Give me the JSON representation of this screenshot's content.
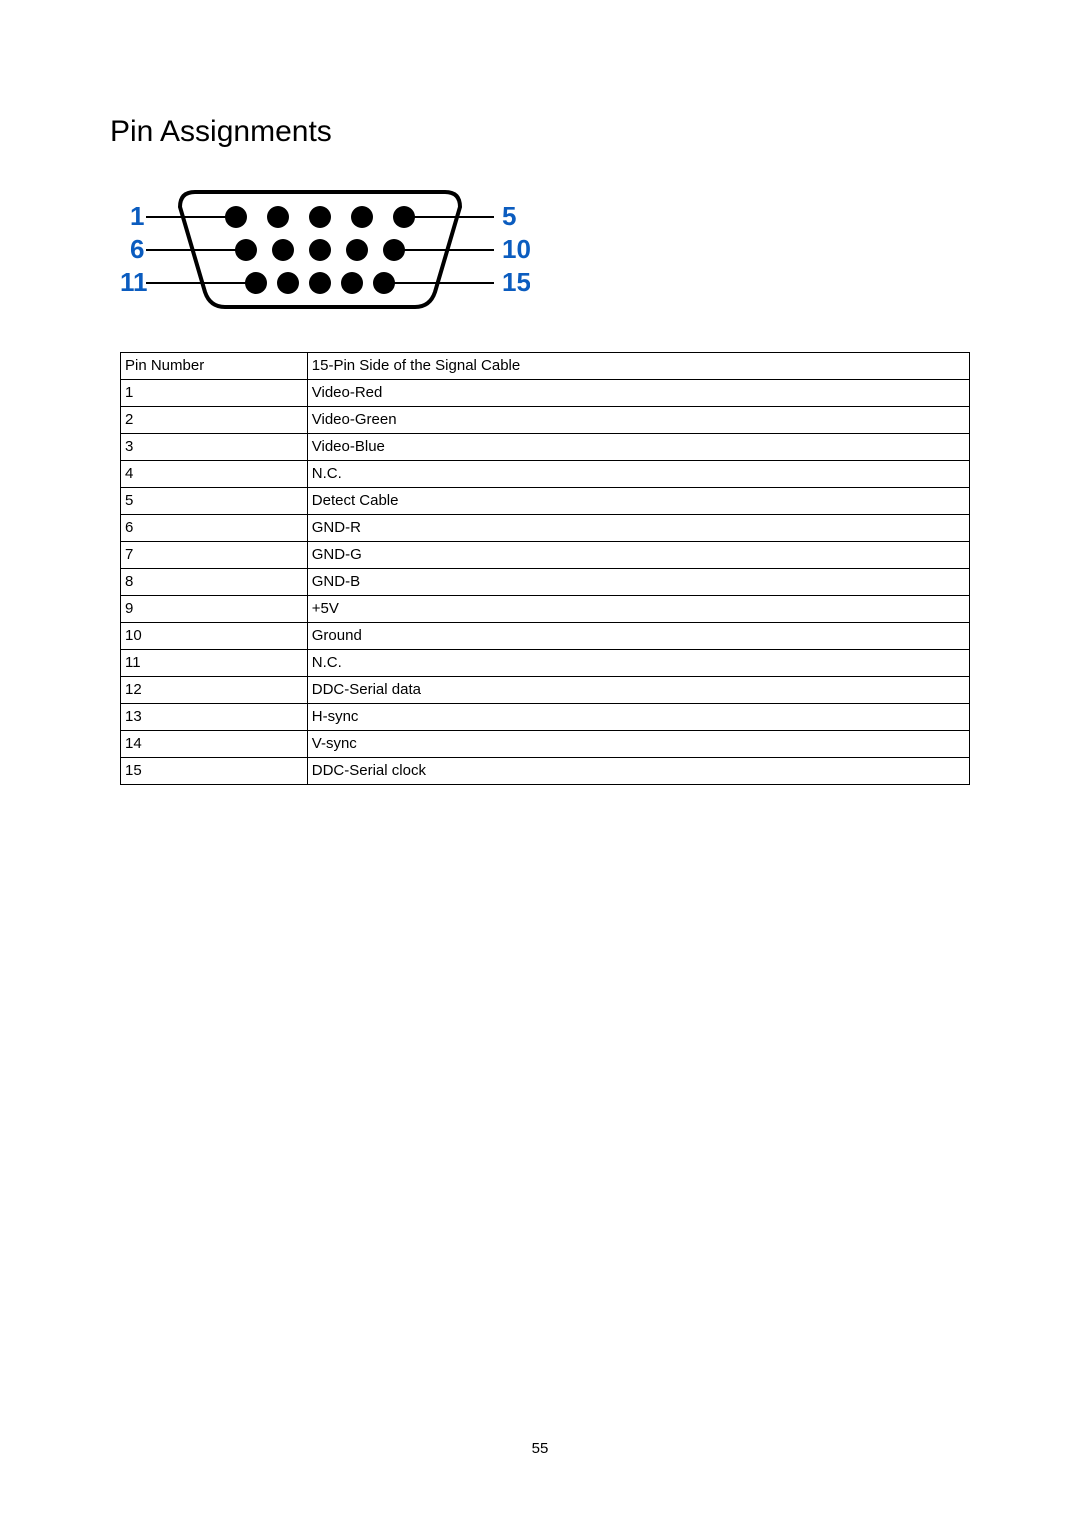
{
  "heading": "Pin Assignments",
  "diagram": {
    "labels": {
      "tl": "1",
      "tr": "5",
      "ml": "6",
      "mr": "10",
      "bl": "11",
      "br": "15"
    }
  },
  "table": {
    "header": {
      "col_a": "Pin Number",
      "col_b": "15-Pin Side of the Signal Cable"
    },
    "rows": [
      {
        "n": "1",
        "d": "Video-Red"
      },
      {
        "n": "2",
        "d": "Video-Green"
      },
      {
        "n": "3",
        "d": "Video-Blue"
      },
      {
        "n": "4",
        "d": "N.C."
      },
      {
        "n": "5",
        "d": "Detect Cable"
      },
      {
        "n": "6",
        "d": "GND-R"
      },
      {
        "n": "7",
        "d": "GND-G"
      },
      {
        "n": "8",
        "d": "GND-B"
      },
      {
        "n": "9",
        "d": "+5V"
      },
      {
        "n": "10",
        "d": "Ground"
      },
      {
        "n": "11",
        "d": "N.C."
      },
      {
        "n": "12",
        "d": "DDC-Serial data"
      },
      {
        "n": "13",
        "d": "H-sync"
      },
      {
        "n": "14",
        "d": "V-sync"
      },
      {
        "n": "15",
        "d": "DDC-Serial clock"
      }
    ]
  },
  "page_number": "55"
}
